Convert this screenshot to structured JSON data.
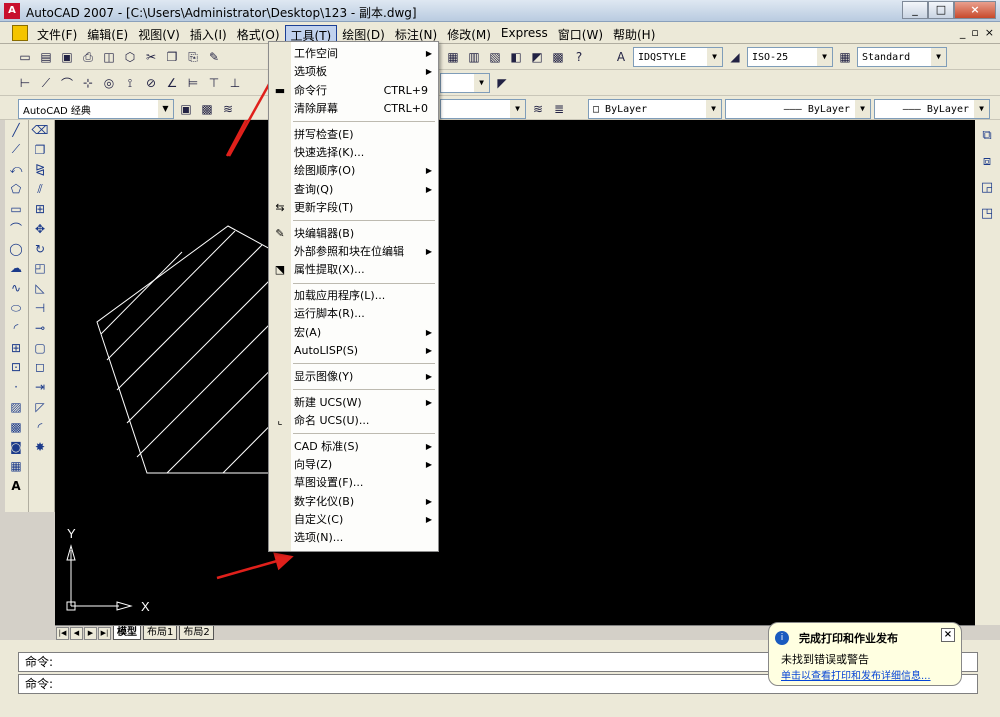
{
  "window": {
    "title": "AutoCAD 2007 - [C:\\Users\\Administrator\\Desktop\\123 - 副本.dwg]",
    "controls": [
      "_",
      "□",
      "×"
    ],
    "mdi_controls": [
      "_",
      "▫",
      "×"
    ]
  },
  "menubar": {
    "items": [
      "文件(F)",
      "编辑(E)",
      "视图(V)",
      "插入(I)",
      "格式(O)",
      "工具(T)",
      "绘图(D)",
      "标注(N)",
      "修改(M)",
      "Express",
      "窗口(W)",
      "帮助(H)"
    ],
    "active": "工具(T)"
  },
  "toolbar": {
    "text_style": "IDQSTYLE",
    "dim_style": "ISO-25",
    "table_style": "Standard",
    "workspace": "AutoCAD 经典",
    "color": "ByLayer",
    "linetype": "ByLayer",
    "lineweight": "ByLayer"
  },
  "tools_menu": {
    "items": [
      {
        "label": "工作空间",
        "submenu": true
      },
      {
        "label": "选项板",
        "submenu": true
      },
      {
        "label": "命令行",
        "shortcut": "CTRL+9",
        "icon": "command-line-icon"
      },
      {
        "label": "清除屏幕",
        "shortcut": "CTRL+0"
      },
      {
        "label": "拼写检查(E)"
      },
      {
        "label": "快速选择(K)..."
      },
      {
        "label": "绘图顺序(O)",
        "submenu": true
      },
      {
        "label": "查询(Q)",
        "submenu": true
      },
      {
        "label": "更新字段(T)",
        "icon": "update-field-icon"
      },
      {
        "label": "块编辑器(B)",
        "icon": "block-editor-icon"
      },
      {
        "label": "外部参照和块在位编辑",
        "submenu": true
      },
      {
        "label": "属性提取(X)...",
        "icon": "attribute-extract-icon"
      },
      {
        "label": "加载应用程序(L)..."
      },
      {
        "label": "运行脚本(R)..."
      },
      {
        "label": "宏(A)",
        "submenu": true
      },
      {
        "label": "AutoLISP(S)",
        "submenu": true
      },
      {
        "label": "显示图像(Y)",
        "submenu": true
      },
      {
        "label": "新建 UCS(W)",
        "submenu": true
      },
      {
        "label": "命名 UCS(U)...",
        "icon": "named-ucs-icon"
      },
      {
        "label": "CAD 标准(S)",
        "submenu": true
      },
      {
        "label": "向导(Z)",
        "submenu": true
      },
      {
        "label": "草图设置(F)..."
      },
      {
        "label": "数字化仪(B)",
        "submenu": true
      },
      {
        "label": "自定义(C)",
        "submenu": true
      },
      {
        "label": "选项(N)..."
      }
    ]
  },
  "layout_tabs": [
    "模型",
    "布局1",
    "布局2"
  ],
  "active_tab": "模型",
  "ucs": {
    "x_label": "X",
    "y_label": "Y"
  },
  "command": {
    "line1": "命令:",
    "line2": "命令:"
  },
  "balloon": {
    "title": "完成打印和作业发布",
    "body": "未找到错误或警告",
    "link": "单击以查看打印和发布详细信息..."
  },
  "colors": {
    "canvas": "#000000",
    "arrow": "#e0201b",
    "menu_highlight": "#c1d2ee"
  }
}
